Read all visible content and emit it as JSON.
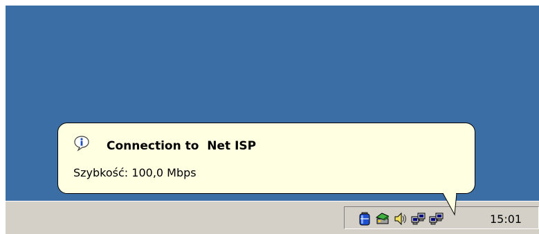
{
  "balloon": {
    "title": "Connection to  Net ISP",
    "message": "Szybkość: 100,0 Mbps"
  },
  "tray": {
    "icons": [
      "battery-icon",
      "safely-remove-hardware-icon",
      "volume-icon",
      "network-connection-icon",
      "network-connection-icon"
    ],
    "clock": "15:01"
  },
  "colors": {
    "desktop": "#3a6ea5",
    "taskbar": "#d4d0c8",
    "balloon": "#ffffe1"
  }
}
